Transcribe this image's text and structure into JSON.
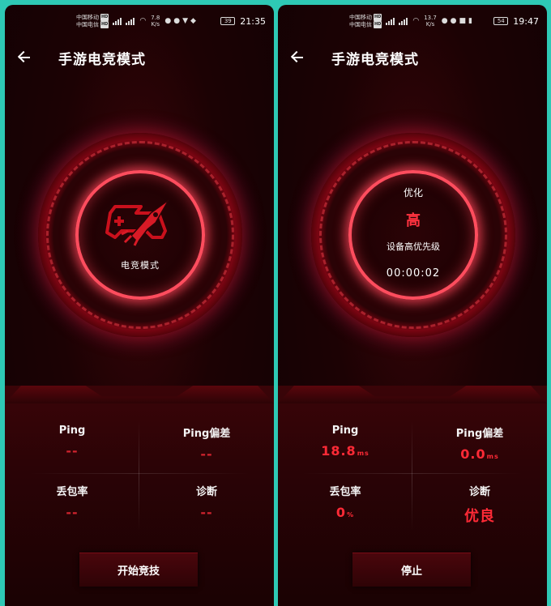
{
  "colors": {
    "accent": "#ff2a36",
    "frame": "#2ec9b5",
    "background": "#1c0204"
  },
  "left": {
    "status": {
      "carrier1": "中国移动",
      "carrier2": "中国电信",
      "hd": "HD",
      "net_speed": "7.8",
      "net_unit": "K/s",
      "battery": "39",
      "time": "21:35"
    },
    "header": {
      "title": "手游电竞模式"
    },
    "dial": {
      "label": "电竞模式",
      "icon": "gamepad-rocket-icon"
    },
    "stats": {
      "ping_label": "Ping",
      "ping_value": "--",
      "deviation_label": "Ping偏差",
      "deviation_value": "--",
      "loss_label": "丢包率",
      "loss_value": "--",
      "diagnosis_label": "诊断",
      "diagnosis_value": "--"
    },
    "button": {
      "label": "开始竞技"
    }
  },
  "right": {
    "status": {
      "carrier1": "中国移动",
      "carrier2": "中国电信",
      "hd": "HD",
      "net_speed": "13.7",
      "net_unit": "K/s",
      "battery": "54",
      "time": "19:47"
    },
    "header": {
      "title": "手游电竞模式"
    },
    "dial": {
      "label": "优化",
      "level": "高",
      "priority": "设备高优先级",
      "timer": "00:00:02"
    },
    "stats": {
      "ping_label": "Ping",
      "ping_value": "18.8",
      "ping_unit": "ms",
      "deviation_label": "Ping偏差",
      "deviation_value": "0.0",
      "deviation_unit": "ms",
      "loss_label": "丢包率",
      "loss_value": "0",
      "loss_unit": "%",
      "diagnosis_label": "诊断",
      "diagnosis_value": "优良"
    },
    "button": {
      "label": "停止"
    }
  }
}
